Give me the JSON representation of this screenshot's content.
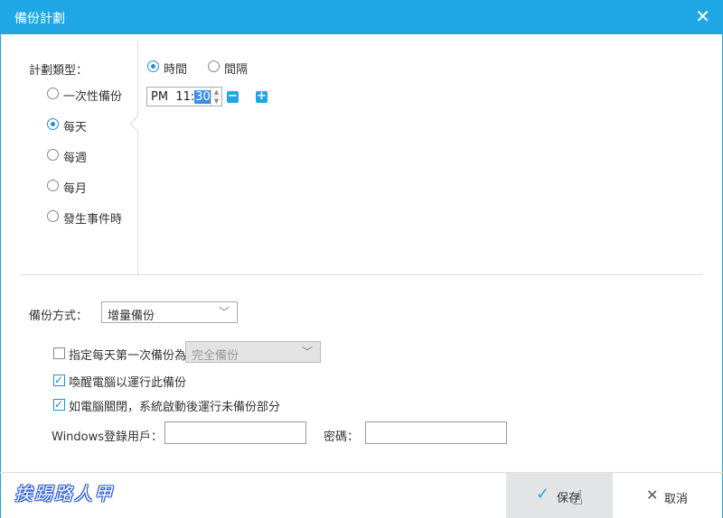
{
  "window": {
    "title": "備份計劃",
    "close_icon": "close-icon"
  },
  "schedule": {
    "type_label": "計劃類型：",
    "types": [
      {
        "label": "一次性備份",
        "checked": false
      },
      {
        "label": "每天",
        "checked": true
      },
      {
        "label": "每週",
        "checked": false
      },
      {
        "label": "每月",
        "checked": false
      },
      {
        "label": "發生事件時",
        "checked": false
      }
    ],
    "mode_options": [
      {
        "label": "時間",
        "checked": true
      },
      {
        "label": "間隔",
        "checked": false
      }
    ],
    "time": {
      "ampm": "PM",
      "hour": "11",
      "sep": ":",
      "minute": "30"
    }
  },
  "backup": {
    "method_label": "備份方式：",
    "method_value": "增量備份",
    "first_daily_label": "指定每天第一次備份為",
    "first_daily_checked": false,
    "first_daily_value": "完全備份",
    "wake_label": "喚醒電腦以運行此備份",
    "wake_checked": true,
    "run_missed_label": "如電腦關閉，系統啟動後運行未備份部分",
    "run_missed_checked": true,
    "windows_user_label": "Windows登錄用戶：",
    "windows_user_value": "",
    "password_label": "密碼：",
    "password_value": ""
  },
  "footer": {
    "watermark": "挨踢路人甲",
    "save_label": "保存",
    "cancel_label": "取消"
  }
}
